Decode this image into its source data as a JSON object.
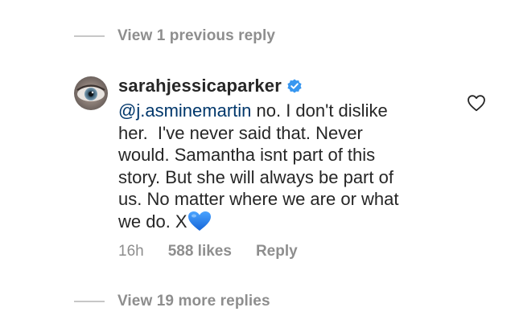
{
  "thread": {
    "previous_replies_label": "View 1 previous reply",
    "more_replies_label": "View 19 more replies"
  },
  "comment": {
    "username": "sarahjessicaparker",
    "verified": true,
    "mention": "@j.asminemartin",
    "lines": [
      " no. I don't dislike",
      "her.  I've never said that. Never",
      "would. Samantha isnt part of this",
      "story. But she will always be part of",
      "us. No matter where we are or what",
      "we do. X"
    ],
    "emoji": "blue-heart",
    "time": "16h",
    "likes": "588 likes",
    "reply_label": "Reply"
  },
  "icons": {
    "verified_badge": "verified-badge-icon",
    "like": "heart-outline-icon",
    "emoji": "blue-heart-emoji"
  },
  "colors": {
    "verified_blue": "#3897f0",
    "mention": "#00376b",
    "secondary_text": "#8e8e8e",
    "primary_text": "#262626",
    "heart_blue": "#1f7ee8"
  }
}
